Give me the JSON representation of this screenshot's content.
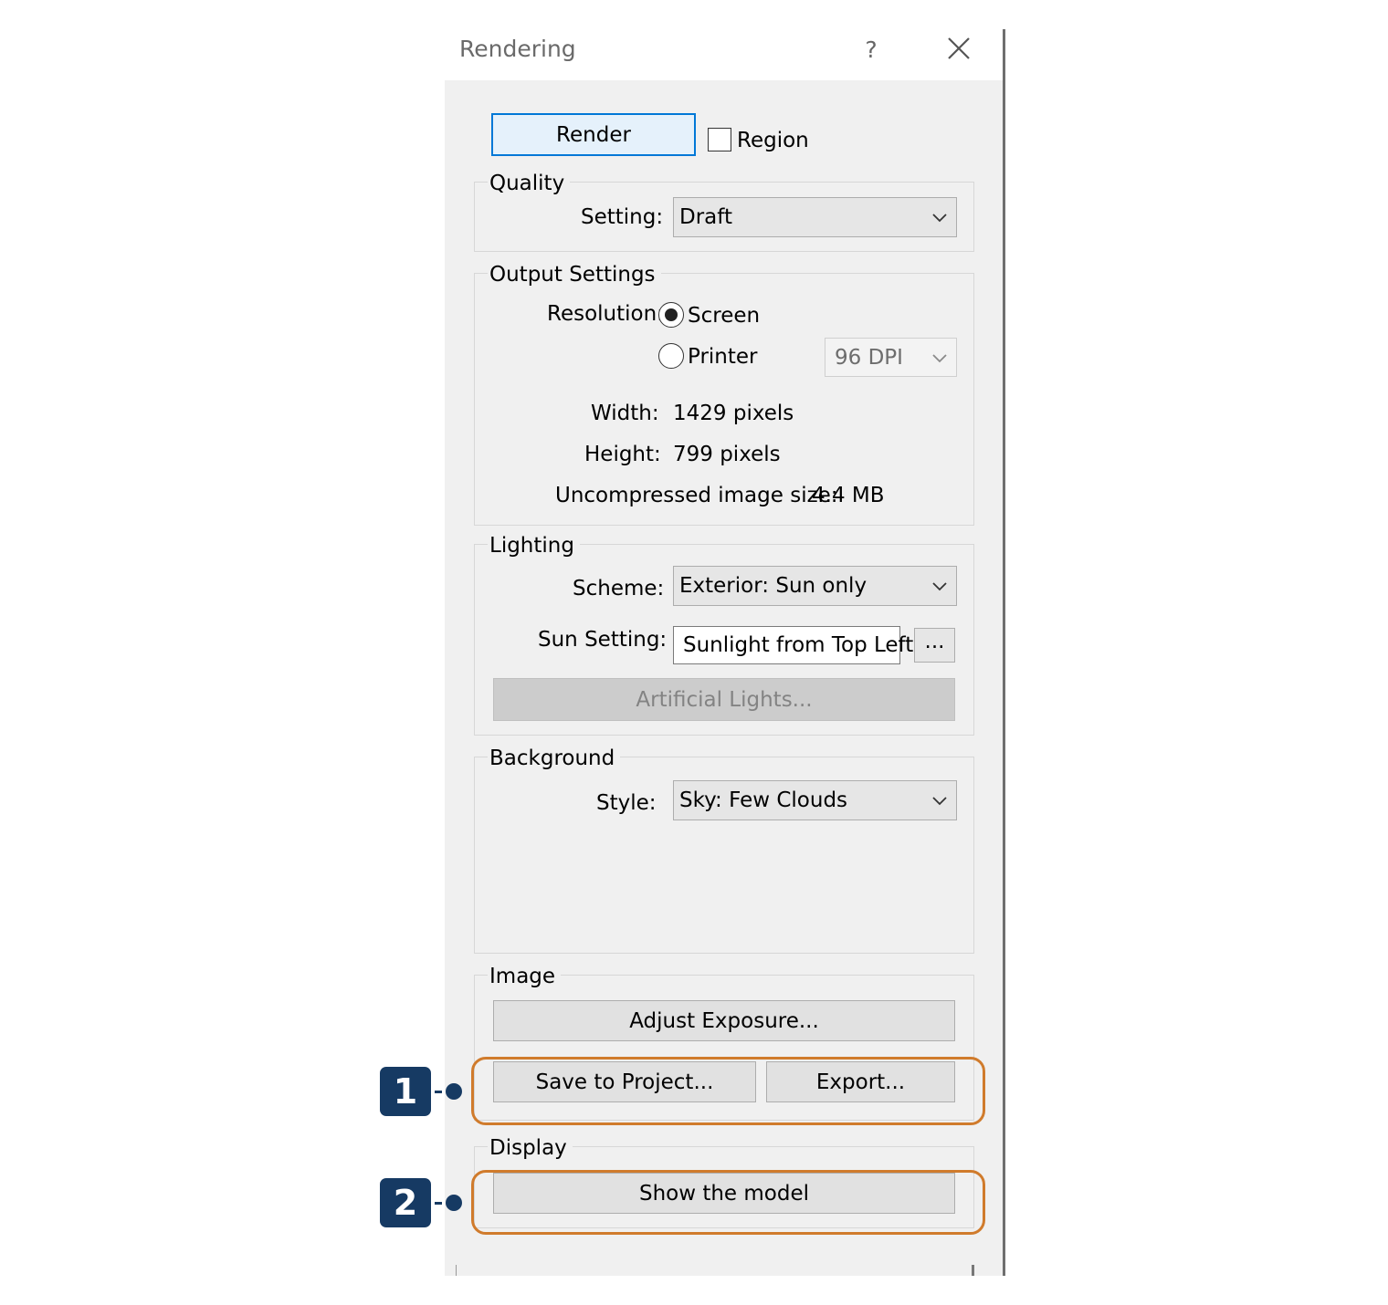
{
  "dialog": {
    "title": "Rendering",
    "help_label": "?",
    "render_label": "Render",
    "region_label": "Region",
    "region_checked": false
  },
  "quality": {
    "legend": "Quality",
    "setting_label": "Setting:",
    "setting_value": "Draft"
  },
  "output": {
    "legend": "Output Settings",
    "resolution_label": "Resolution:",
    "screen_label": "Screen",
    "printer_label": "Printer",
    "selected": "Screen",
    "dpi_value": "96 DPI",
    "width_label": "Width:",
    "width_value": "1429 pixels",
    "height_label": "Height:",
    "height_value": "799 pixels",
    "size_label": "Uncompressed image size:",
    "size_value": "4.4 MB"
  },
  "lighting": {
    "legend": "Lighting",
    "scheme_label": "Scheme:",
    "scheme_value": "Exterior: Sun only",
    "sun_label": "Sun Setting:",
    "sun_value": "Sunlight from Top Left",
    "browse_label": "...",
    "artificial_label": "Artificial Lights..."
  },
  "background": {
    "legend": "Background",
    "style_label": "Style:",
    "style_value": "Sky: Few Clouds"
  },
  "image": {
    "legend": "Image",
    "adjust_label": "Adjust Exposure...",
    "save_label": "Save to Project...",
    "export_label": "Export..."
  },
  "display": {
    "legend": "Display",
    "show_model_label": "Show the model"
  },
  "callouts": {
    "one": "1",
    "two": "2",
    "color": "#163a63",
    "highlight_color": "#d07b2c"
  }
}
